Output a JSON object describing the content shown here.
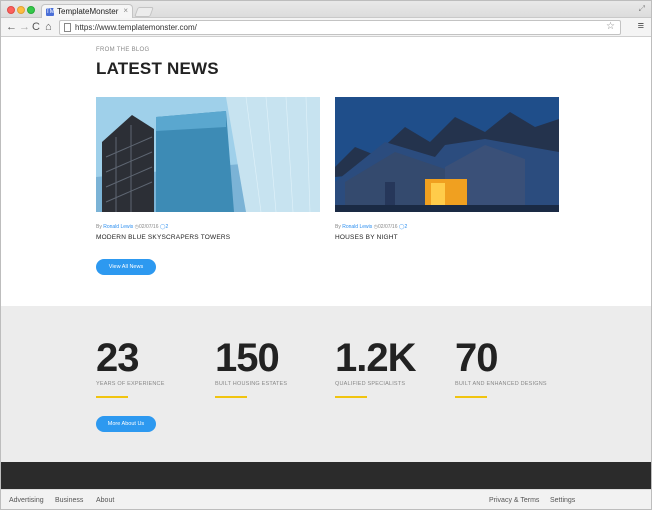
{
  "browser": {
    "tab_title": "TemplateMonster",
    "tab_close": "×",
    "url": "https://www.templatemonster.com/",
    "nav": {
      "back": "←",
      "forward": "→",
      "reload": "C",
      "home": "⌂",
      "star": "☆",
      "menu": "≡",
      "restore": "⤢",
      "favicon": "TM"
    }
  },
  "news": {
    "eyebrow": "From the blog",
    "heading": "LATEST NEWS",
    "posts": [
      {
        "by": "By",
        "author": "Ronald Lewis",
        "date": "02/07/16",
        "comments": "2",
        "title": "MODERN BLUE SKYSCRAPERS TOWERS"
      },
      {
        "by": "By",
        "author": "Ronald Lewis",
        "date": "02/07/16",
        "comments": "2",
        "title": "HOUSES BY NIGHT"
      }
    ],
    "button": "View All News"
  },
  "stats": {
    "items": [
      {
        "value": "23",
        "label": "Years of experience"
      },
      {
        "value": "150",
        "label": "Built housing estates"
      },
      {
        "value": "1.2K",
        "label": "Qualified specialists"
      },
      {
        "value": "70",
        "label": "Built and enhanced designs"
      }
    ],
    "button": "More About Us"
  },
  "footer": {
    "left_links": [
      "Advertising",
      "Business",
      "About"
    ],
    "right_links": [
      "Privacy & Terms",
      "Settings"
    ]
  },
  "colors": {
    "accent": "#2d99f0",
    "stat_bar": "#f1c40f",
    "stats_bg": "#ececec",
    "dark_band": "#2b2b2b"
  }
}
